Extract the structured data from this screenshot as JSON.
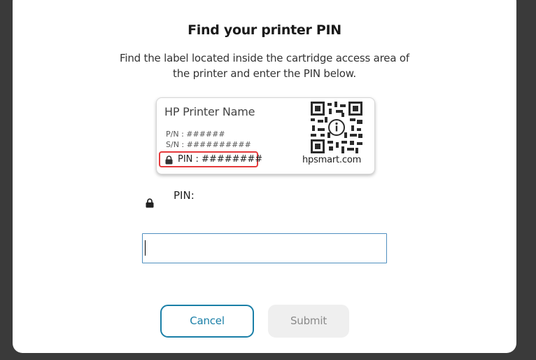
{
  "dialog": {
    "title": "Find your printer PIN",
    "description": "Find the label located inside the cartridge access area of the printer and enter the PIN below."
  },
  "label_card": {
    "printer_name": "HP Printer Name",
    "pn": "P/N : ######",
    "sn": "S/N : ##########",
    "pin": "PIN : ########",
    "url": "hpsmart.com",
    "highlight_color": "#e5393b",
    "qr_icon": "qr-code-icon"
  },
  "pin_field": {
    "label": "PIN:",
    "value": "",
    "lock_icon": "lock-icon"
  },
  "buttons": {
    "cancel": "Cancel",
    "submit": "Submit"
  },
  "colors": {
    "accent": "#1a7fa7",
    "input_border": "#4f8fbf",
    "disabled_bg": "#efefef",
    "backdrop": "#3a3a3a"
  }
}
